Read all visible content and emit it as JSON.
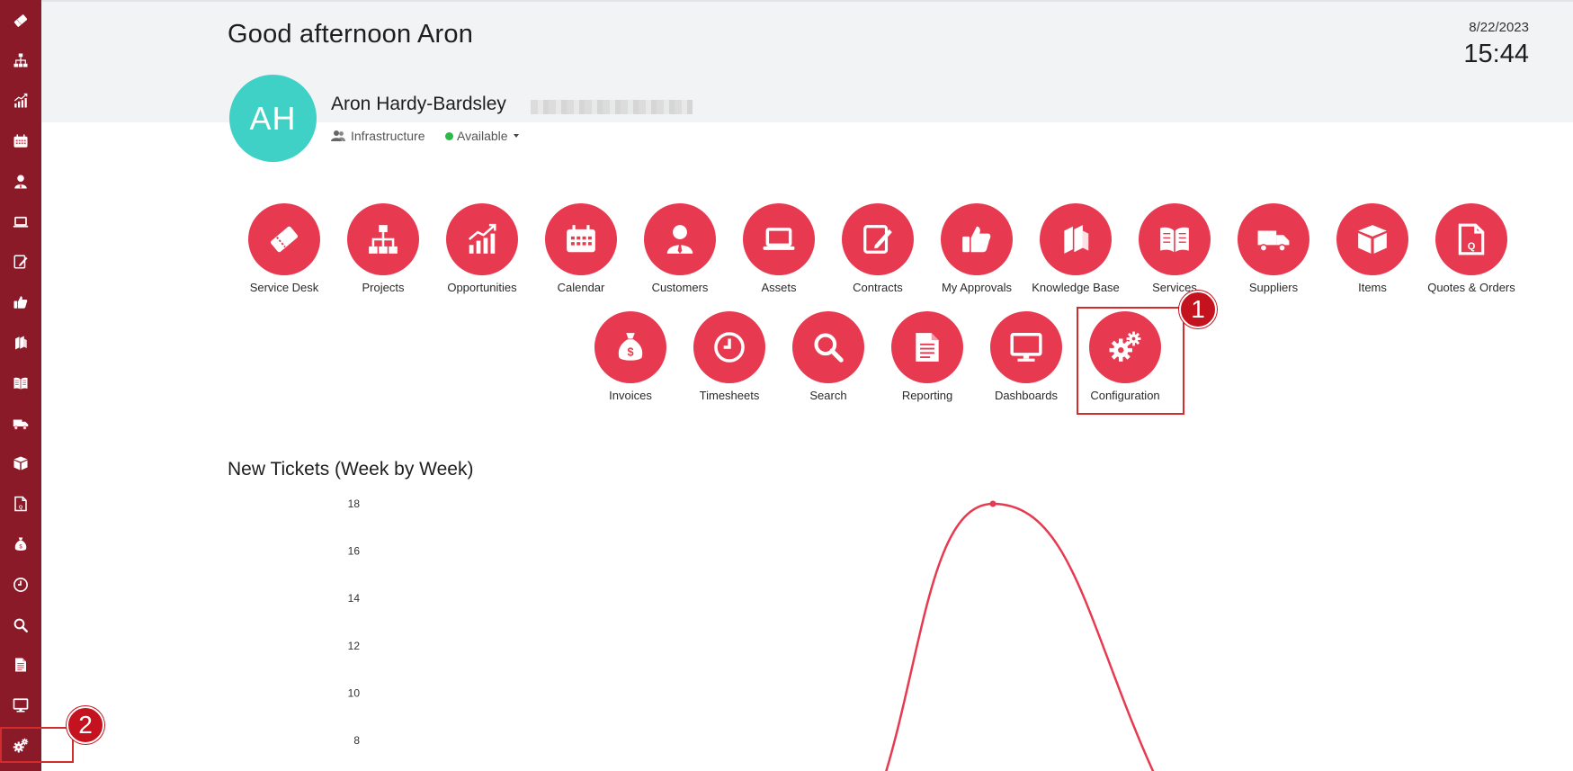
{
  "header": {
    "greeting": "Good afternoon Aron",
    "date": "8/22/2023",
    "time": "15:44"
  },
  "user": {
    "initials": "AH",
    "name": "Aron Hardy-Bardsley",
    "team": "Infrastructure",
    "status": "Available",
    "avatar_color": "#3fd1c6",
    "status_color": "#2db84b"
  },
  "sidebar": {
    "items": [
      {
        "icon": "ticket-icon"
      },
      {
        "icon": "hierarchy-icon"
      },
      {
        "icon": "growth-chart-icon"
      },
      {
        "icon": "calendar-icon"
      },
      {
        "icon": "customer-icon"
      },
      {
        "icon": "laptop-icon"
      },
      {
        "icon": "contract-pen-icon"
      },
      {
        "icon": "thumbs-up-icon"
      },
      {
        "icon": "books-icon"
      },
      {
        "icon": "open-book-icon"
      },
      {
        "icon": "truck-icon"
      },
      {
        "icon": "box-icon"
      },
      {
        "icon": "quote-document-icon"
      },
      {
        "icon": "money-bag-icon"
      },
      {
        "icon": "clock-icon"
      },
      {
        "icon": "search-icon"
      },
      {
        "icon": "report-document-icon"
      },
      {
        "icon": "monitor-icon"
      },
      {
        "icon": "gears-icon"
      }
    ]
  },
  "tiles": {
    "row1": [
      {
        "label": "Service Desk",
        "icon": "ticket-icon"
      },
      {
        "label": "Projects",
        "icon": "hierarchy-icon"
      },
      {
        "label": "Opportunities",
        "icon": "growth-chart-icon"
      },
      {
        "label": "Calendar",
        "icon": "calendar-icon"
      },
      {
        "label": "Customers",
        "icon": "customer-icon"
      },
      {
        "label": "Assets",
        "icon": "laptop-icon"
      },
      {
        "label": "Contracts",
        "icon": "contract-pen-icon"
      },
      {
        "label": "My Approvals",
        "icon": "thumbs-up-icon"
      },
      {
        "label": "Knowledge Base",
        "icon": "books-icon"
      },
      {
        "label": "Services",
        "icon": "open-book-icon"
      },
      {
        "label": "Suppliers",
        "icon": "truck-icon"
      },
      {
        "label": "Items",
        "icon": "box-icon"
      },
      {
        "label": "Quotes & Orders",
        "icon": "quote-document-icon"
      }
    ],
    "row2": [
      {
        "label": "Invoices",
        "icon": "money-bag-icon"
      },
      {
        "label": "Timesheets",
        "icon": "clock-icon"
      },
      {
        "label": "Search",
        "icon": "search-icon"
      },
      {
        "label": "Reporting",
        "icon": "report-document-icon"
      },
      {
        "label": "Dashboards",
        "icon": "monitor-icon"
      },
      {
        "label": "Configuration",
        "icon": "gears-icon"
      }
    ],
    "accent_color": "#e73a50"
  },
  "callouts": {
    "badge1": "1",
    "badge2": "2",
    "color": "#c4121f"
  },
  "chart_title": "New Tickets (Week by Week)",
  "chart_data": {
    "type": "line",
    "title": "New Tickets (Week by Week)",
    "xlabel": "",
    "ylabel": "",
    "y_ticks": [
      "18",
      "16",
      "14",
      "12",
      "10",
      "8"
    ],
    "series": [
      {
        "points": [
          [
            0,
            6.8
          ],
          [
            0.5,
            18
          ],
          [
            1,
            6.8
          ]
        ],
        "peak_value": 18,
        "color": "#e73a50"
      }
    ],
    "grid": false
  },
  "sidebar_color": "#8b1a29"
}
